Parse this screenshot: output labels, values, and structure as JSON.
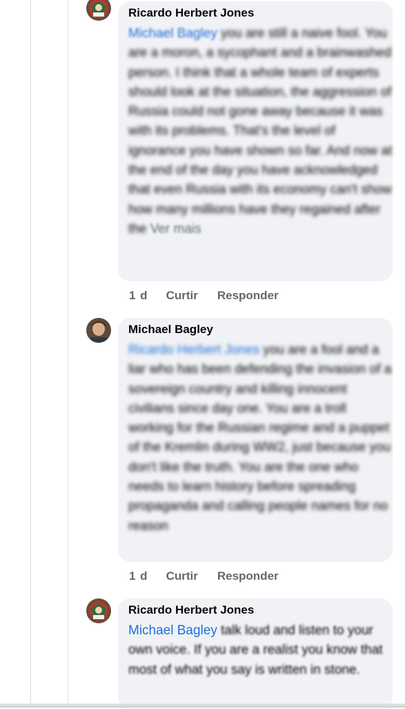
{
  "comments": [
    {
      "author": "Ricardo Herbert Jones",
      "mention": "Michael Bagley",
      "text_after_mention": " you are still a naive fool. You are a moron, a sycophant and a brainwashed person. I think that a whole team of experts should look at the situation, the aggression of Russia could not gone away because it was with its problems. That's the level of ignorance you have shown so far. And now at the end of the day you have acknowledged that even Russia with its economy can't show how many millions have they regained after the",
      "see_more": "Ver mais",
      "time": "1 d",
      "like_label": "Curtir",
      "reply_label": "Responder"
    },
    {
      "author": "Michael Bagley",
      "mention": "Ricardo Herbert Jones",
      "text": "you are a fool and a liar who has been defending the invasion of a sovereign country and killing innocent civilians since day one. You are a troll working for the Russian regime and a puppet of the Kremlin during WW2, just because you don't like the truth. You are the one who needs to learn history before spreading propaganda and calling people names for no reason",
      "time": "1 d",
      "like_label": "Curtir",
      "reply_label": "Responder"
    },
    {
      "author": "Ricardo Herbert Jones",
      "mention": "Michael Bagley",
      "text_after_mention": " talk loud and listen to your own voice. If you are a realist you know that most of what you say is written in stone."
    }
  ]
}
